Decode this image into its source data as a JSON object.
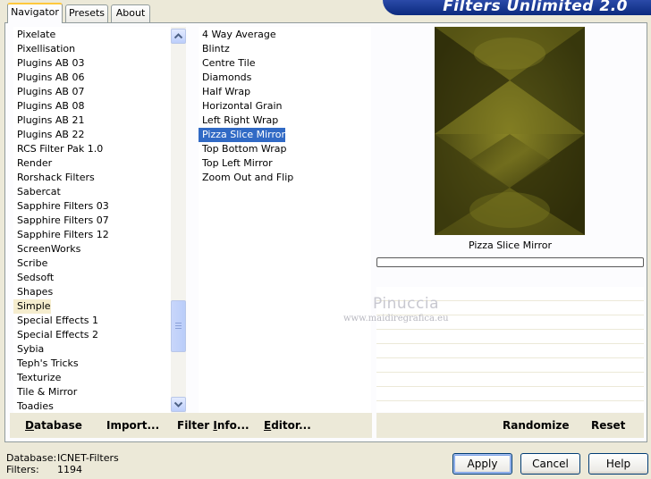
{
  "app": {
    "title": "Filters Unlimited 2.0"
  },
  "tabs": [
    {
      "label": "Navigator",
      "active": true
    },
    {
      "label": "Presets",
      "active": false
    },
    {
      "label": "About",
      "active": false
    }
  ],
  "categories": {
    "items": [
      "Pixelate",
      "Pixellisation",
      "Plugins AB 03",
      "Plugins AB 06",
      "Plugins AB 07",
      "Plugins AB 08",
      "Plugins AB 21",
      "Plugins AB 22",
      "RCS Filter Pak 1.0",
      "Render",
      "Rorshack Filters",
      "Sabercat",
      "Sapphire Filters 03",
      "Sapphire Filters 07",
      "Sapphire Filters 12",
      "ScreenWorks",
      "Scribe",
      "Sedsoft",
      "Shapes",
      "Simple",
      "Special Effects 1",
      "Special Effects 2",
      "Sybia",
      "Teph's Tricks",
      "Texturize",
      "Tile & Mirror",
      "Toadies"
    ],
    "selected": "Simple"
  },
  "filters": {
    "items": [
      "4 Way Average",
      "Blintz",
      "Centre Tile",
      "Diamonds",
      "Half Wrap",
      "Horizontal Grain",
      "Left Right Wrap",
      "Pizza Slice Mirror",
      "Top Bottom Wrap",
      "Top Left Mirror",
      "Zoom Out and Flip"
    ],
    "selected": "Pizza Slice Mirror"
  },
  "preview": {
    "filter_name": "Pizza Slice Mirror",
    "progress": 0
  },
  "toolbar_left": {
    "database_pre": "",
    "database_key": "D",
    "database_post": "atabase",
    "import_pre": "Import",
    "import_key": "",
    "import_post": "...",
    "filterinfo_pre": "Filter ",
    "filterinfo_key": "I",
    "filterinfo_post": "nfo...",
    "editor_pre": "",
    "editor_key": "E",
    "editor_post": "ditor..."
  },
  "toolbar_right": {
    "randomize": "Randomize",
    "reset": "Reset"
  },
  "watermark": {
    "name": "Pinuccia",
    "url": "www.maidiregrafica.eu"
  },
  "footer": {
    "database_label": "Database:",
    "database_value": "ICNET-Filters",
    "filters_label": "Filters:",
    "filters_value": "1194"
  },
  "buttons": {
    "apply": "Apply",
    "cancel": "Cancel",
    "help": "Help"
  },
  "colors": {
    "window_bg": "#ece9d8",
    "selection": "#316ac5",
    "category_highlight": "#f5edce",
    "banner": "#0b2a7e",
    "preview_dark": "#2f2f0a",
    "preview_light": "#7c7a20"
  }
}
